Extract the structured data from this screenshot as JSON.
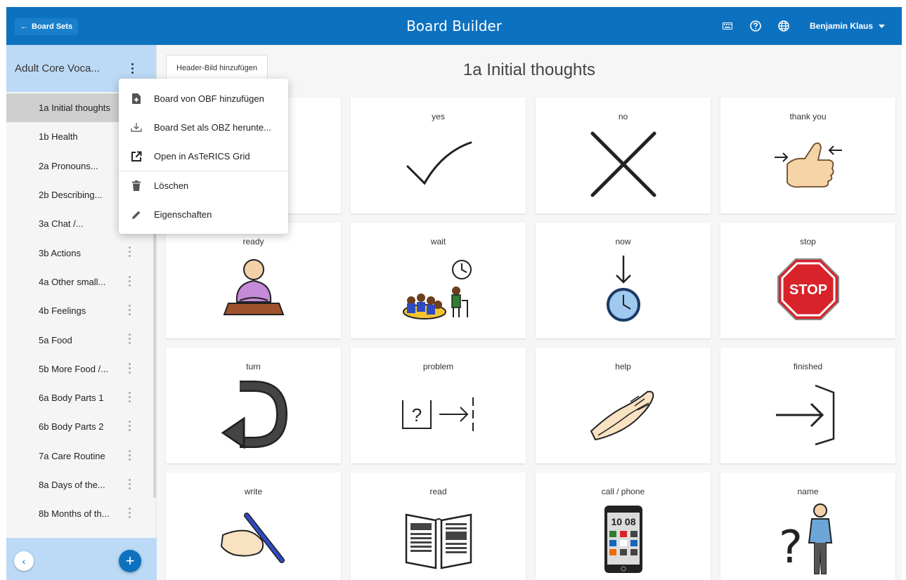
{
  "topbar": {
    "back_label": "Board Sets",
    "title": "Board Builder",
    "user_name": "Benjamin Klaus",
    "icons": [
      "keyboard-icon",
      "help-icon",
      "globe-icon"
    ]
  },
  "sidebar": {
    "set_name": "Adult Core Voca...",
    "boards": [
      {
        "label": "1a Initial thoughts",
        "active": true
      },
      {
        "label": "1b Health"
      },
      {
        "label": "2a Pronouns..."
      },
      {
        "label": "2b Describing..."
      },
      {
        "label": "3a Chat /..."
      },
      {
        "label": "3b Actions"
      },
      {
        "label": "4a Other small..."
      },
      {
        "label": "4b Feelings"
      },
      {
        "label": "5a Food"
      },
      {
        "label": "5b More Food /..."
      },
      {
        "label": "6a Body Parts 1"
      },
      {
        "label": "6b Body Parts 2"
      },
      {
        "label": "7a Care Routine"
      },
      {
        "label": "8a Days of the..."
      },
      {
        "label": "8b Months of th..."
      }
    ]
  },
  "menu": {
    "items": [
      {
        "label": "Board von OBF hinzufügen",
        "icon": "file-add-icon"
      },
      {
        "label": "Board Set als OBZ herunte...",
        "icon": "download-icon"
      },
      {
        "label": "Open in AsTeRICS Grid",
        "icon": "open-external-icon"
      },
      {
        "label": "Löschen",
        "icon": "trash-icon"
      },
      {
        "label": "Eigenschaften",
        "icon": "pencil-icon"
      }
    ]
  },
  "main": {
    "header_image_button": "Header-Bild hinzufügen",
    "board_title": "1a Initial thoughts",
    "tiles": [
      {
        "label": "",
        "icon": "blank"
      },
      {
        "label": "yes",
        "icon": "checkmark-icon"
      },
      {
        "label": "no",
        "icon": "cross-icon"
      },
      {
        "label": "thank you",
        "icon": "thumbs-up-icon"
      },
      {
        "label": "ready",
        "icon": "person-ready-icon"
      },
      {
        "label": "wait",
        "icon": "wait-group-icon"
      },
      {
        "label": "now",
        "icon": "clock-arrow-icon"
      },
      {
        "label": "stop",
        "icon": "stop-sign-icon",
        "sign_text": "STOP"
      },
      {
        "label": "turn",
        "icon": "turn-arrow-icon"
      },
      {
        "label": "problem",
        "icon": "problem-icon",
        "sign_text": "?"
      },
      {
        "label": "help",
        "icon": "helping-hands-icon"
      },
      {
        "label": "finished",
        "icon": "finished-arrow-icon"
      },
      {
        "label": "write",
        "icon": "hand-writing-icon"
      },
      {
        "label": "read",
        "icon": "open-book-icon"
      },
      {
        "label": "call / phone",
        "icon": "phone-icon",
        "phone_time": "10 08"
      },
      {
        "label": "name",
        "icon": "person-question-icon",
        "sign_text": "?"
      }
    ]
  },
  "colors": {
    "topbar": "#0c72c0",
    "sidebar_header": "#bcdaf6",
    "active_item": "#cfcfcf",
    "stop_red": "#d8232a"
  }
}
